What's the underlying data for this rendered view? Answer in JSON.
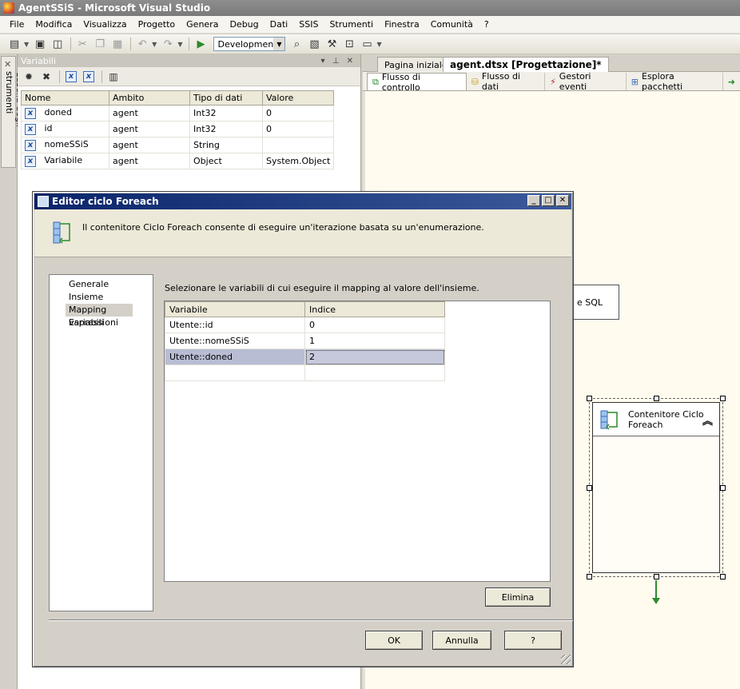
{
  "window": {
    "title": "AgentSSiS - Microsoft Visual Studio"
  },
  "menu": [
    "File",
    "Modifica",
    "Visualizza",
    "Progetto",
    "Genera",
    "Debug",
    "Dati",
    "SSIS",
    "Strumenti",
    "Finestra",
    "Comunità",
    "?"
  ],
  "toolbar": {
    "configuration": "Development"
  },
  "toolbox": {
    "label": "Casella degli strumenti"
  },
  "variables_panel": {
    "title": "Variabili",
    "columns": [
      "Nome",
      "Ambito",
      "Tipo di dati",
      "Valore"
    ],
    "rows": [
      {
        "name": "doned",
        "scope": "agent",
        "type": "Int32",
        "value": "0"
      },
      {
        "name": "id",
        "scope": "agent",
        "type": "Int32",
        "value": "0"
      },
      {
        "name": "nomeSSiS",
        "scope": "agent",
        "type": "String",
        "value": ""
      },
      {
        "name": "Variabile",
        "scope": "agent",
        "type": "Object",
        "value": "System.Object"
      }
    ]
  },
  "designer": {
    "tabs": [
      "Pagina iniziale",
      "agent.dtsx [Progettazione]*"
    ],
    "subtabs": [
      "Flusso di controllo",
      "Flusso di dati",
      "Gestori eventi",
      "Esplora pacchetti"
    ],
    "sql_task_label": "e SQL",
    "foreach_container_label": "Contenitore Ciclo Foreach"
  },
  "dialog": {
    "title": "Editor ciclo Foreach",
    "description": "Il contenitore Ciclo Foreach consente di eseguire un'iterazione basata su un'enumerazione.",
    "nav_items": [
      "Generale",
      "Insieme",
      "Mapping variabili",
      "Espressioni"
    ],
    "selected_nav": "Mapping variabili",
    "instruction": "Selezionare le variabili di cui eseguire il mapping al valore dell'insieme.",
    "grid": {
      "columns": [
        "Variabile",
        "Indice"
      ],
      "rows": [
        {
          "variable": "Utente::id",
          "index": "0"
        },
        {
          "variable": "Utente::nomeSSiS",
          "index": "1"
        },
        {
          "variable": "Utente::doned",
          "index": "2"
        }
      ],
      "selected_row": 2
    },
    "buttons": {
      "delete": "Elimina",
      "ok": "OK",
      "cancel": "Annulla",
      "help": "?"
    }
  }
}
